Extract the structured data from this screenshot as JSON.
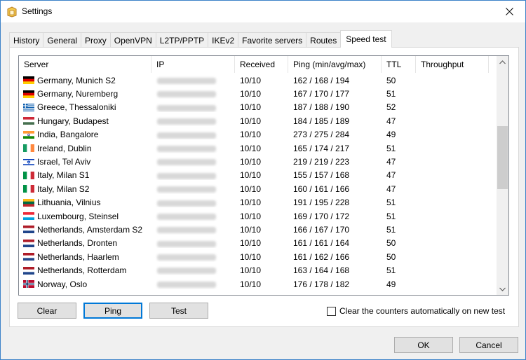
{
  "window": {
    "title": "Settings"
  },
  "tabs": [
    {
      "label": "History",
      "active": false
    },
    {
      "label": "General",
      "active": false
    },
    {
      "label": "Proxy",
      "active": false
    },
    {
      "label": "OpenVPN",
      "active": false
    },
    {
      "label": "L2TP/PPTP",
      "active": false
    },
    {
      "label": "IKEv2",
      "active": false
    },
    {
      "label": "Favorite servers",
      "active": false
    },
    {
      "label": "Routes",
      "active": false
    },
    {
      "label": "Speed test",
      "active": true
    }
  ],
  "table": {
    "columns": [
      "Server",
      "IP",
      "Received",
      "Ping (min/avg/max)",
      "TTL",
      "Throughput"
    ],
    "rows": [
      {
        "flag": "de",
        "server": "Germany, Munich S2",
        "received": "10/10",
        "ping": "162 / 168 / 194",
        "ttl": "50",
        "throughput": ""
      },
      {
        "flag": "de",
        "server": "Germany, Nuremberg",
        "received": "10/10",
        "ping": "167 / 170 / 177",
        "ttl": "51",
        "throughput": ""
      },
      {
        "flag": "gr",
        "server": "Greece, Thessaloniki",
        "received": "10/10",
        "ping": "187 / 188 / 190",
        "ttl": "52",
        "throughput": ""
      },
      {
        "flag": "hu",
        "server": "Hungary, Budapest",
        "received": "10/10",
        "ping": "184 / 185 / 189",
        "ttl": "47",
        "throughput": ""
      },
      {
        "flag": "in",
        "server": "India, Bangalore",
        "received": "10/10",
        "ping": "273 / 275 / 284",
        "ttl": "49",
        "throughput": ""
      },
      {
        "flag": "ie",
        "server": "Ireland, Dublin",
        "received": "10/10",
        "ping": "165 / 174 / 217",
        "ttl": "51",
        "throughput": ""
      },
      {
        "flag": "il",
        "server": "Israel, Tel Aviv",
        "received": "10/10",
        "ping": "219 / 219 / 223",
        "ttl": "47",
        "throughput": ""
      },
      {
        "flag": "it",
        "server": "Italy, Milan S1",
        "received": "10/10",
        "ping": "155 / 157 / 168",
        "ttl": "47",
        "throughput": ""
      },
      {
        "flag": "it",
        "server": "Italy, Milan S2",
        "received": "10/10",
        "ping": "160 / 161 / 166",
        "ttl": "47",
        "throughput": ""
      },
      {
        "flag": "lt",
        "server": "Lithuania, Vilnius",
        "received": "10/10",
        "ping": "191 / 195 / 228",
        "ttl": "51",
        "throughput": ""
      },
      {
        "flag": "lu",
        "server": "Luxembourg, Steinsel",
        "received": "10/10",
        "ping": "169 / 170 / 172",
        "ttl": "51",
        "throughput": ""
      },
      {
        "flag": "nl",
        "server": "Netherlands, Amsterdam S2",
        "received": "10/10",
        "ping": "166 / 167 / 170",
        "ttl": "51",
        "throughput": ""
      },
      {
        "flag": "nl",
        "server": "Netherlands, Dronten",
        "received": "10/10",
        "ping": "161 / 161 / 164",
        "ttl": "50",
        "throughput": ""
      },
      {
        "flag": "nl",
        "server": "Netherlands, Haarlem",
        "received": "10/10",
        "ping": "161 / 162 / 166",
        "ttl": "50",
        "throughput": ""
      },
      {
        "flag": "nl",
        "server": "Netherlands, Rotterdam",
        "received": "10/10",
        "ping": "163 / 164 / 168",
        "ttl": "51",
        "throughput": ""
      },
      {
        "flag": "no",
        "server": "Norway, Oslo",
        "received": "10/10",
        "ping": "176 / 178 / 182",
        "ttl": "49",
        "throughput": ""
      }
    ]
  },
  "buttons": {
    "clear": "Clear",
    "ping": "Ping",
    "test": "Test",
    "ok": "OK",
    "cancel": "Cancel"
  },
  "checkbox": {
    "label": "Clear the counters automatically on new test",
    "checked": false
  },
  "icons": {
    "title": "settings-app-icon",
    "close": "close-icon",
    "scroll_up": "chevron-up-icon",
    "scroll_down": "chevron-down-icon"
  },
  "colors": {
    "accent": "#0078d7",
    "window_border": "#3c82c8"
  }
}
